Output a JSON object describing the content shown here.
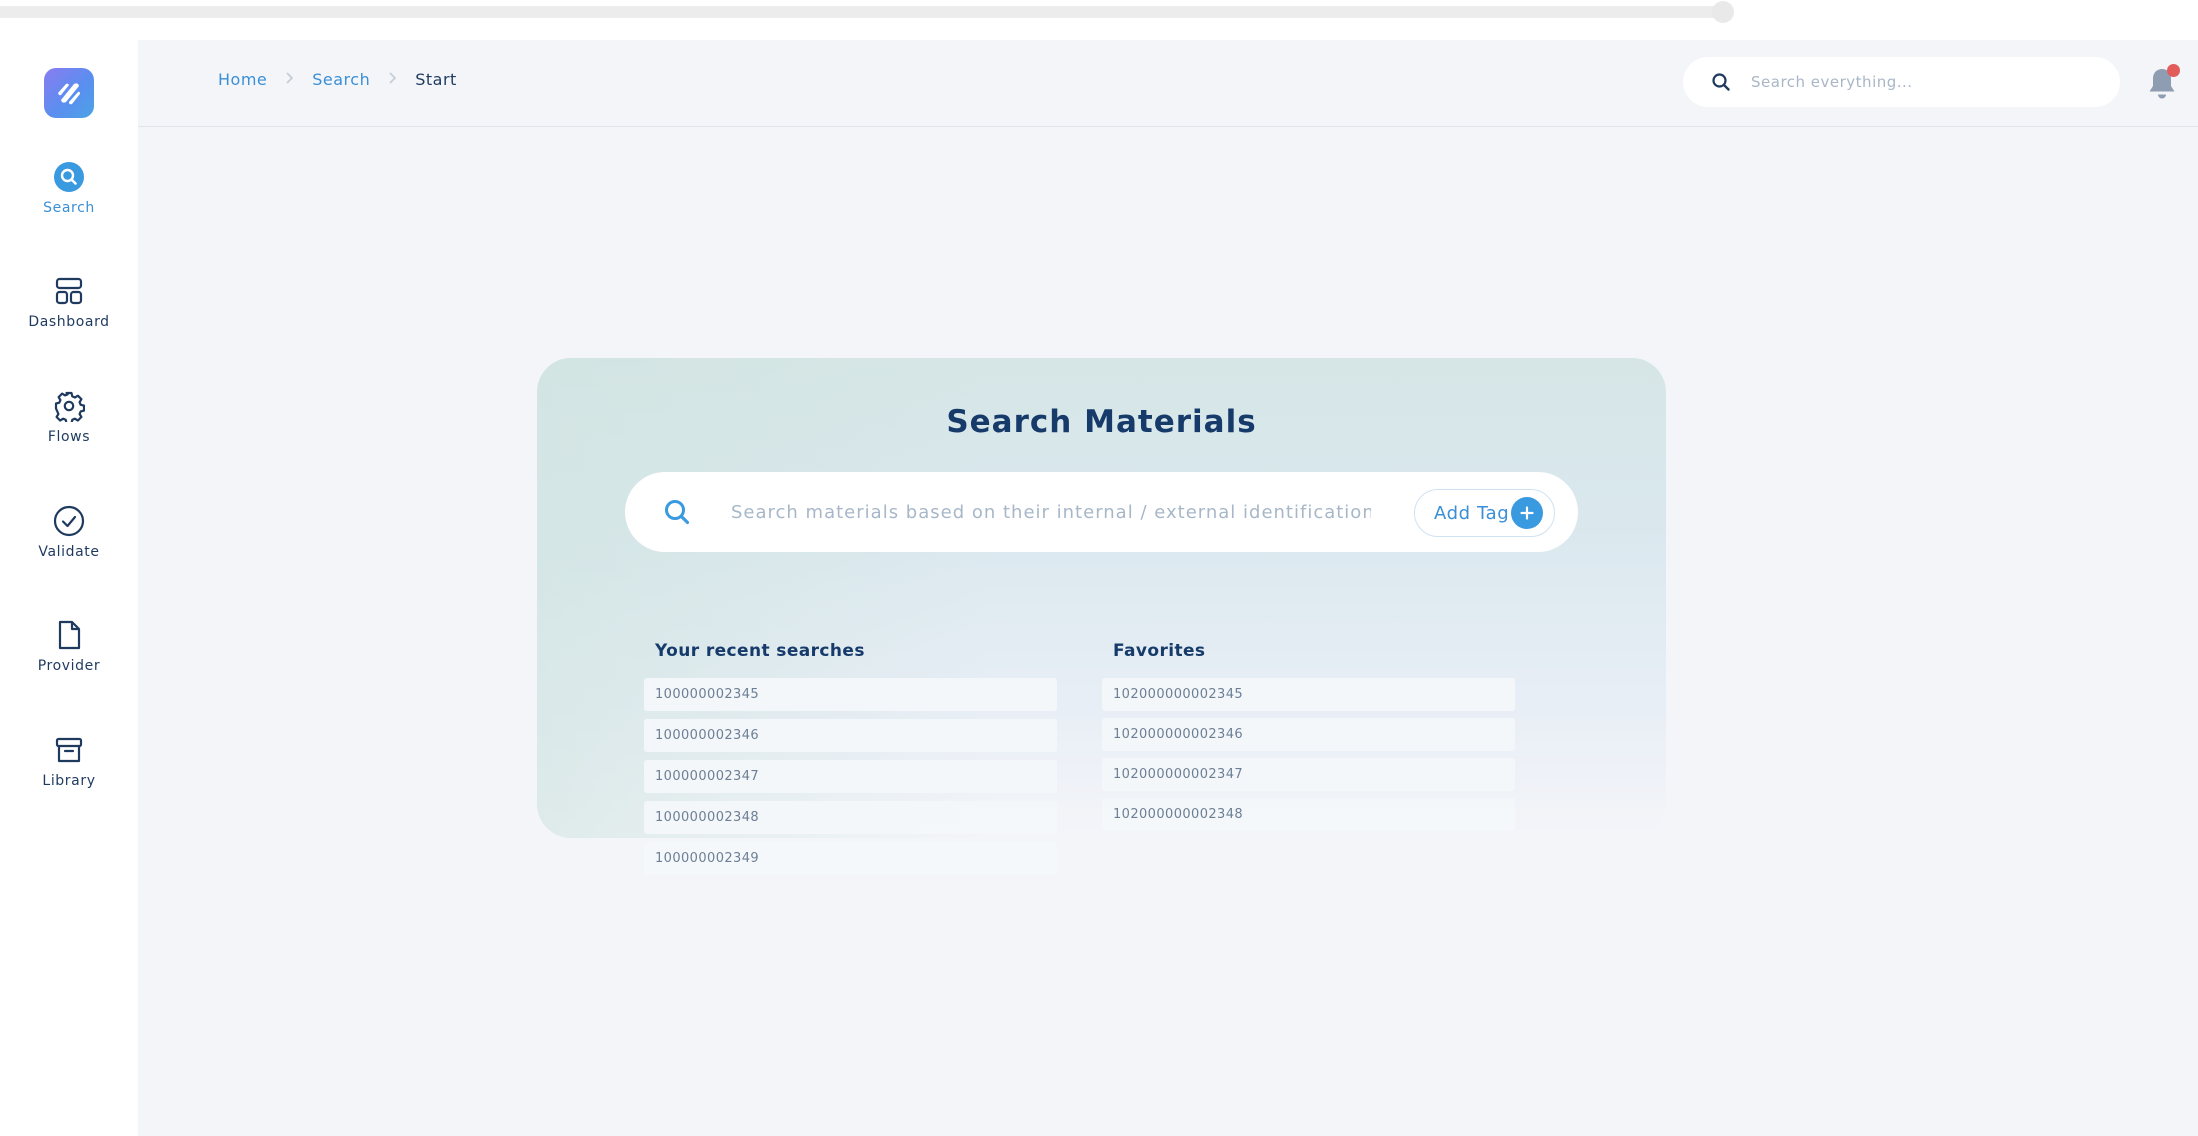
{
  "breadcrumb": {
    "home": "Home",
    "search": "Search",
    "current": "Start"
  },
  "global_search": {
    "placeholder": "Search everything..."
  },
  "sidebar": {
    "items": [
      {
        "label": "Search",
        "icon": "search-icon",
        "active": true
      },
      {
        "label": "Dashboard",
        "icon": "dashboard-icon",
        "active": false
      },
      {
        "label": "Flows",
        "icon": "gear-icon",
        "active": false
      },
      {
        "label": "Validate",
        "icon": "check-circle-icon",
        "active": false
      },
      {
        "label": "Provider",
        "icon": "file-icon",
        "active": false
      },
      {
        "label": "Library",
        "icon": "archive-icon",
        "active": false
      }
    ]
  },
  "search_card": {
    "title": "Search Materials",
    "placeholder": "Search materials based on their internal / external identification...",
    "add_tag_label": "Add Tag"
  },
  "recent_searches": {
    "title": "Your recent searches",
    "items": [
      "100000002345",
      "100000002346",
      "100000002347",
      "100000002348",
      "100000002349"
    ]
  },
  "favorites": {
    "title": "Favorites",
    "items": [
      "102000000002345",
      "102000000002346",
      "102000000002347",
      "102000000002348"
    ]
  },
  "colors": {
    "accent": "#3a8fd6",
    "title": "#163a6a",
    "notification_dot": "#e25c5c"
  }
}
